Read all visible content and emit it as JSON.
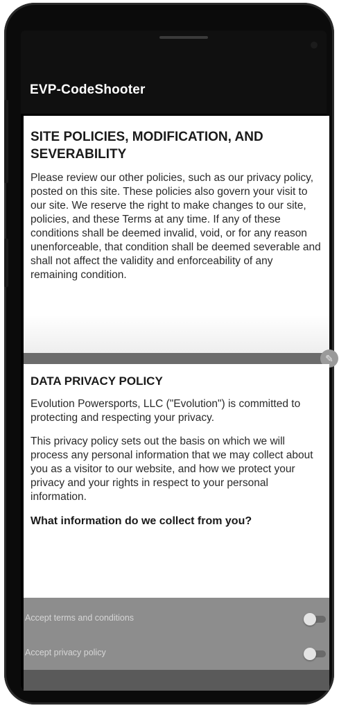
{
  "app": {
    "title": "EVP-CodeShooter"
  },
  "policies": {
    "heading": "SITE POLICIES, MODIFICATION, AND SEVERABILITY",
    "body": "Please review our other policies, such as our privacy policy, posted on this site. These policies also govern your visit to our site. We reserve the right to make changes to our site, policies, and these Terms at any time. If any of these conditions shall be deemed invalid, void, or for any reason unenforceable, that condition shall be deemed severable and shall not affect the validity and enforceability of any remaining condition."
  },
  "privacy": {
    "heading": "DATA PRIVACY POLICY",
    "para1": "Evolution Powersports, LLC (\"Evolution\") is committed to protecting and respecting your privacy.",
    "para2": "This privacy policy sets out the basis on which we will process any personal information that we may collect about you as a visitor to our website, and how we protect your privacy and your rights in respect to your personal information.",
    "question": "What information do we collect from you?"
  },
  "settings": {
    "accept_terms": {
      "label": "Accept terms and conditions",
      "checked": false
    },
    "accept_privacy": {
      "label": "Accept privacy policy",
      "checked": false
    }
  },
  "divider_icon": "pencil-icon",
  "colors": {
    "toolbar": "#101010",
    "panel": "#ffffff",
    "settings_bg": "#8d8d8d",
    "divider": "#6c6c6c"
  }
}
